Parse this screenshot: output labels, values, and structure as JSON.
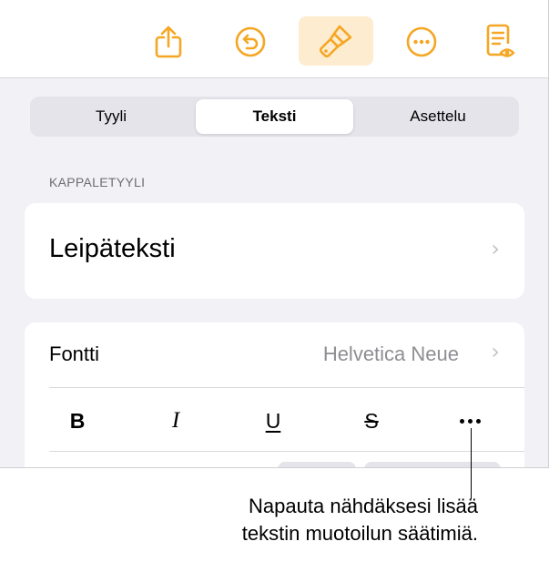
{
  "toolbar": {
    "buttons": [
      {
        "icon": "share-icon"
      },
      {
        "icon": "undo-icon"
      },
      {
        "icon": "format-brush-icon",
        "active": true
      },
      {
        "icon": "more-icon"
      },
      {
        "icon": "reading-view-icon"
      }
    ],
    "accent_color": "#f5a623",
    "active_bg": "#fdeccf"
  },
  "tabs": [
    {
      "label": "Tyyli",
      "selected": false
    },
    {
      "label": "Teksti",
      "selected": true
    },
    {
      "label": "Asettelu",
      "selected": false
    }
  ],
  "paragraph_style": {
    "header": "KAPPALETYYLI",
    "value": "Leipäteksti"
  },
  "font": {
    "label": "Fontti",
    "value": "Helvetica Neue"
  },
  "format_buttons": {
    "bold": "B",
    "italic": "I",
    "underline": "U",
    "strikethrough": "S"
  },
  "callout": {
    "line1": "Napauta nähdäksesi lisää",
    "line2": "tekstin muotoilun säätimiä."
  }
}
